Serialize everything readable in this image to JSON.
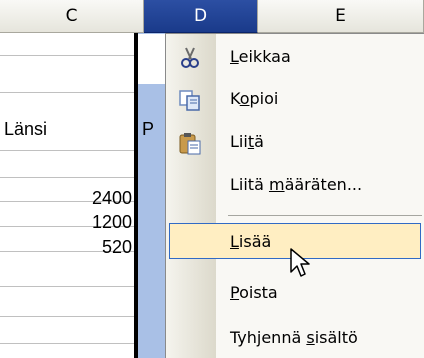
{
  "columns": {
    "c": "C",
    "d": "D",
    "e": "E"
  },
  "cells": {
    "lansi": "Länsi",
    "partial_p": "P",
    "v1": "2400",
    "v2": "1200",
    "v3": "520"
  },
  "menu": {
    "items": [
      {
        "pre": "",
        "acc": "L",
        "post": "eikkaa",
        "icon": "scissors-icon"
      },
      {
        "pre": "K",
        "acc": "o",
        "post": "pioi",
        "icon": "copy-icon"
      },
      {
        "pre": "Lii",
        "acc": "t",
        "post": "ä",
        "icon": "paste-icon"
      },
      {
        "pre": "Liitä ",
        "acc": "m",
        "post": "ääräten...",
        "icon": ""
      },
      {
        "pre": "",
        "acc": "L",
        "post": "isää",
        "icon": ""
      },
      {
        "pre": "",
        "acc": "P",
        "post": "oista",
        "icon": ""
      },
      {
        "pre": "Tyhjennä ",
        "acc": "s",
        "post": "isältö",
        "icon": ""
      }
    ]
  },
  "colors": {
    "menu_highlight": "#ffeec2",
    "highlight_border": "#316ac5",
    "selected_column": "#a9c0e6"
  }
}
